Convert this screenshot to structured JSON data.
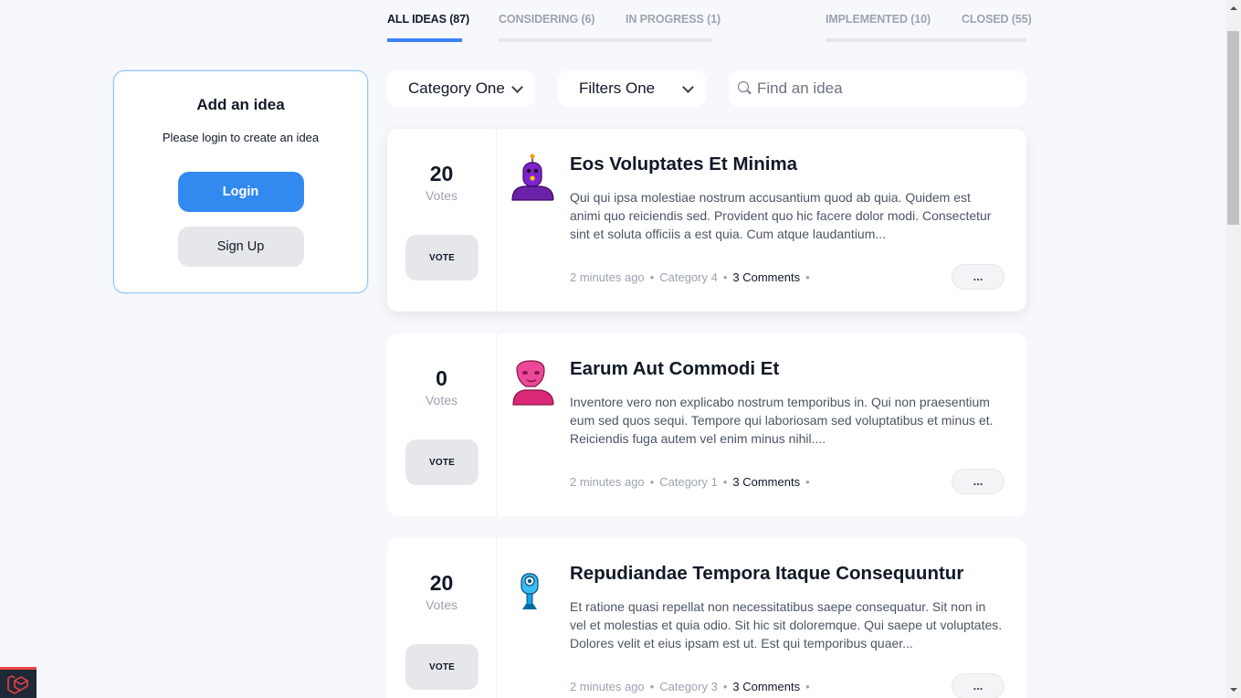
{
  "tabs": [
    {
      "label": "ALL IDEAS (87)",
      "active": true
    },
    {
      "label": "CONSIDERING (6)",
      "active": false
    },
    {
      "label": "IN PROGRESS (1)",
      "active": false
    },
    {
      "label": "IMPLEMENTED (10)",
      "active": false
    },
    {
      "label": "CLOSED (55)",
      "active": false
    }
  ],
  "sidebar": {
    "title": "Add an idea",
    "subtitle": "Please login to create an idea",
    "login_label": "Login",
    "signup_label": "Sign Up"
  },
  "filters": {
    "category": "Category One",
    "filter": "Filters One",
    "search_placeholder": "Find an idea"
  },
  "ideas": [
    {
      "votes": "20",
      "votes_label": "Votes",
      "vote_button": "VOTE",
      "title": "Eos Voluptates Et Minima",
      "description": "Qui qui ipsa molestiae nostrum accusantium quod ab quia. Quidem est animi quo reiciendis sed. Provident quo hic facere dolor modi. Consectetur sint et soluta officiis a est quia. Cum atque laudantium...",
      "time": "2 minutes ago",
      "category": "Category 4",
      "comments": "3 Comments",
      "more_label": "...",
      "avatar_icon": "robot-purple-icon",
      "avatar_color": "#7e22ce"
    },
    {
      "votes": "0",
      "votes_label": "Votes",
      "vote_button": "VOTE",
      "title": "Earum Aut Commodi Et",
      "description": "Inventore vero non explicabo nostrum temporibus in. Qui non praesentium eum sed quos sequi. Tempore qui laboriosam sed voluptatibus et minus et. Reiciendis fuga autem vel enim minus nihil....",
      "time": "2 minutes ago",
      "category": "Category 1",
      "comments": "3 Comments",
      "more_label": "...",
      "avatar_icon": "robot-pink-icon",
      "avatar_color": "#ec4899"
    },
    {
      "votes": "20",
      "votes_label": "Votes",
      "vote_button": "VOTE",
      "title": "Repudiandae Tempora Itaque Consequuntur",
      "description": "Et ratione quasi repellat non necessitatibus saepe consequatur. Sit non in vel et molestias et quia odio. Sit hic sit doloremque. Qui saepe ut voluptates. Dolores velit et eius ipsam est ut. Est qui temporibus quaer...",
      "time": "2 minutes ago",
      "category": "Category 3",
      "comments": "3 Comments",
      "more_label": "...",
      "avatar_icon": "robot-blue-icon",
      "avatar_color": "#38bdf8"
    }
  ],
  "colors": {
    "accent": "#328af1",
    "background": "#f7f8fc"
  }
}
